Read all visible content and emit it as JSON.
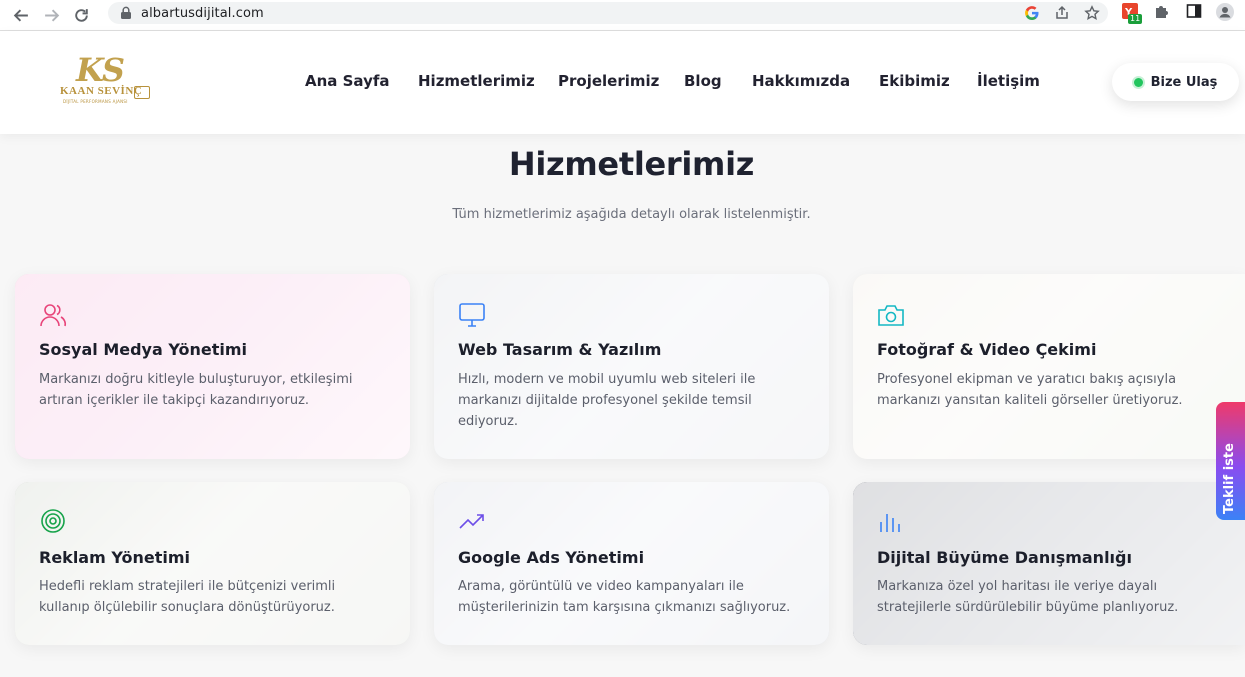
{
  "browser": {
    "url": "albartusdijital.com",
    "extension_badge": "11"
  },
  "logo": {
    "monogram": "KS",
    "name": "KAAN SEVİNÇ",
    "tagline": "DİJİTAL PERFORMANS AJANSI"
  },
  "nav": {
    "items": [
      {
        "label": "Ana Sayfa"
      },
      {
        "label": "Hizmetlerimiz"
      },
      {
        "label": "Projelerimiz"
      },
      {
        "label": "Blog"
      },
      {
        "label": "Hakkımızda"
      },
      {
        "label": "Ekibimiz"
      },
      {
        "label": "İletişim"
      }
    ],
    "cta_label": "Bize Ulaş"
  },
  "section": {
    "title": "Hizmetlerimiz",
    "subtitle": "Tüm hizmetlerimiz aşağıda detaylı olarak listelenmiştir."
  },
  "services": [
    {
      "icon": "users-icon",
      "title": "Sosyal Medya Yönetimi",
      "description": "Markanızı doğru kitleyle buluşturuyor, etkileşimi artıran içerikler ile takipçi kazandırıyoruz.",
      "icon_color": "#e8457a"
    },
    {
      "icon": "monitor-icon",
      "title": "Web Tasarım & Yazılım",
      "description": "Hızlı, modern ve mobil uyumlu web siteleri ile markanızı dijitalde profesyonel şekilde temsil ediyoruz.",
      "icon_color": "#3b82f6"
    },
    {
      "icon": "camera-icon",
      "title": "Fotoğraf & Video Çekimi",
      "description": "Profesyonel ekipman ve yaratıcı bakış açısıyla markanızı yansıtan kaliteli görseller üretiyoruz.",
      "icon_color": "#14b8c4"
    },
    {
      "icon": "target-icon",
      "title": "Reklam Yönetimi",
      "description": "Hedefli reklam stratejileri ile bütçenizi verimli kullanıp ölçülebilir sonuçlara dönüştürüyoruz.",
      "icon_color": "#16a34a"
    },
    {
      "icon": "trending-up-icon",
      "title": "Google Ads Yönetimi",
      "description": "Arama, görüntülü ve video kampanyaları ile müşterilerinizin tam karşısına çıkmanızı sağlıyoruz.",
      "icon_color": "#6d4ee8"
    },
    {
      "icon": "bar-chart-icon",
      "title": "Dijital Büyüme Danışmanlığı",
      "description": "Markanıza özel yol haritası ile veriye dayalı stratejilerle sürdürülebilir büyüme planlıyoruz.",
      "icon_color": "#3b82f6"
    }
  ],
  "side_tab": {
    "label": "Teklif iste"
  }
}
